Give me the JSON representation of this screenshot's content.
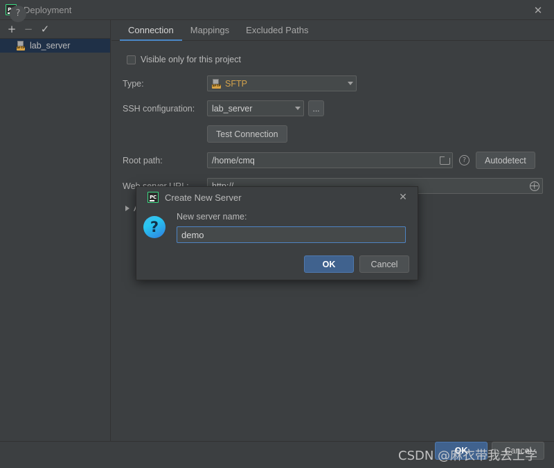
{
  "window": {
    "title": "Deployment",
    "icon": "pycharm-logo",
    "close_label": "✕"
  },
  "left_panel": {
    "toolbar": [
      {
        "name": "add",
        "glyph": "+"
      },
      {
        "name": "remove",
        "glyph": "−"
      },
      {
        "name": "set-default",
        "glyph": "✓"
      }
    ],
    "servers": [
      {
        "label": "lab_server",
        "type_badge": "SFTP",
        "selected": true
      }
    ]
  },
  "tabs": [
    {
      "label": "Connection",
      "active": true
    },
    {
      "label": "Mappings",
      "active": false
    },
    {
      "label": "Excluded Paths",
      "active": false
    }
  ],
  "form": {
    "visible_only_checkbox_label": "Visible only for this project",
    "type_label": "Type:",
    "type_value": "SFTP",
    "type_badge": "SFTP",
    "ssh_label": "SSH configuration:",
    "ssh_value": "lab_server",
    "ssh_browse_label": "...",
    "test_connection_label": "Test Connection",
    "root_path_label": "Root path:",
    "root_path_value": "/home/cmq",
    "autodetect_label": "Autodetect",
    "help_glyph": "?",
    "web_url_label": "Web server URL:",
    "web_url_value": "http://",
    "advanced_label": "Advanced options"
  },
  "bottom": {
    "help_glyph": "?",
    "ok_label": "OK",
    "cancel_label": "Cancel"
  },
  "watermark": {
    "text": "CSDN @麻衣带我去上学"
  },
  "dialog": {
    "title": "Create New Server",
    "icon": "pycharm-logo",
    "close_label": "✕",
    "question_glyph": "?",
    "field_label": "New server name:",
    "field_value": "demo",
    "field_placeholder": "",
    "ok_label": "OK",
    "cancel_label": "Cancel"
  },
  "colors": {
    "accent": "#4a88c7",
    "primary_button": "#40628e",
    "panel": "#3c3f41",
    "selection": "#1f3047",
    "sftp_badge": "#d8a243",
    "logo_green": "#3ddc84"
  }
}
